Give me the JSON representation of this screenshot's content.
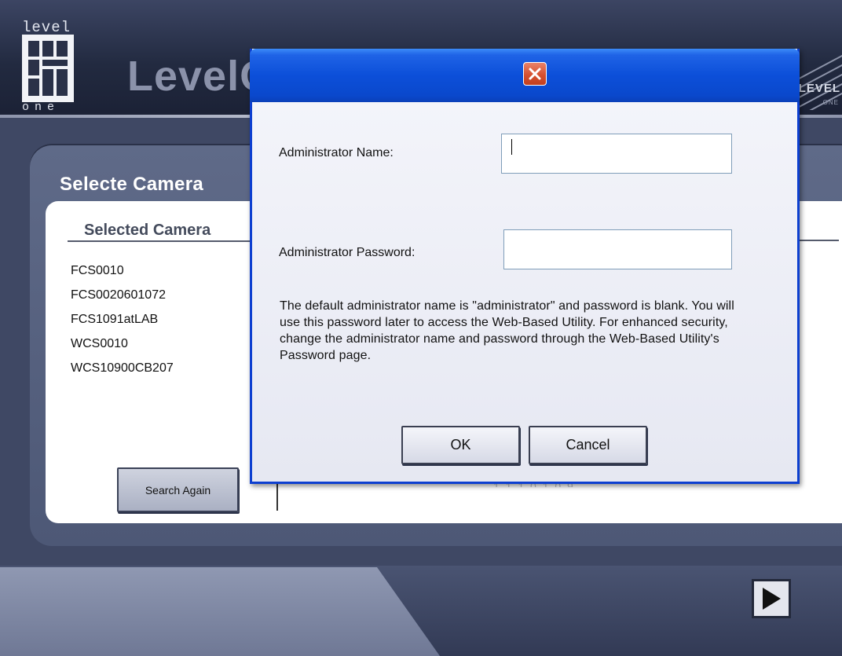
{
  "header": {
    "logo_top_text": "level",
    "logo_bottom_text": "one",
    "brand_name": "LevelO",
    "brand_right": "LEVEL",
    "brand_right_sub": "ONE"
  },
  "panel": {
    "title": "Selecte Camera",
    "column_header": "Selected Camera",
    "cameras": [
      "FCS0010",
      "FCS0020601072",
      "FCS1091atLAB",
      "WCS0010",
      "WCS10900CB207"
    ],
    "search_again_label": "Search Again",
    "partial_ip_text": "1.1.1.0.1.0.9"
  },
  "footer": {
    "next_icon": "play-arrow-icon"
  },
  "dialog": {
    "title": "",
    "close_icon": "close-x-icon",
    "admin_name_label": "Administrator Name:",
    "admin_name_value": "",
    "admin_password_label": "Administrator Password:",
    "admin_password_value": "",
    "message": "The default administrator name is \"administrator\" and password is blank. You will use this password later to access the Web-Based Utility. For enhanced security, change the administrator name and password through the Web-Based Utility's Password page.",
    "ok_label": "OK",
    "cancel_label": "Cancel"
  },
  "colors": {
    "titlebar_blue": "#0c4fd9",
    "close_red": "#d6502f",
    "panel_slate": "#5f6a88",
    "background": "#3f4864"
  }
}
